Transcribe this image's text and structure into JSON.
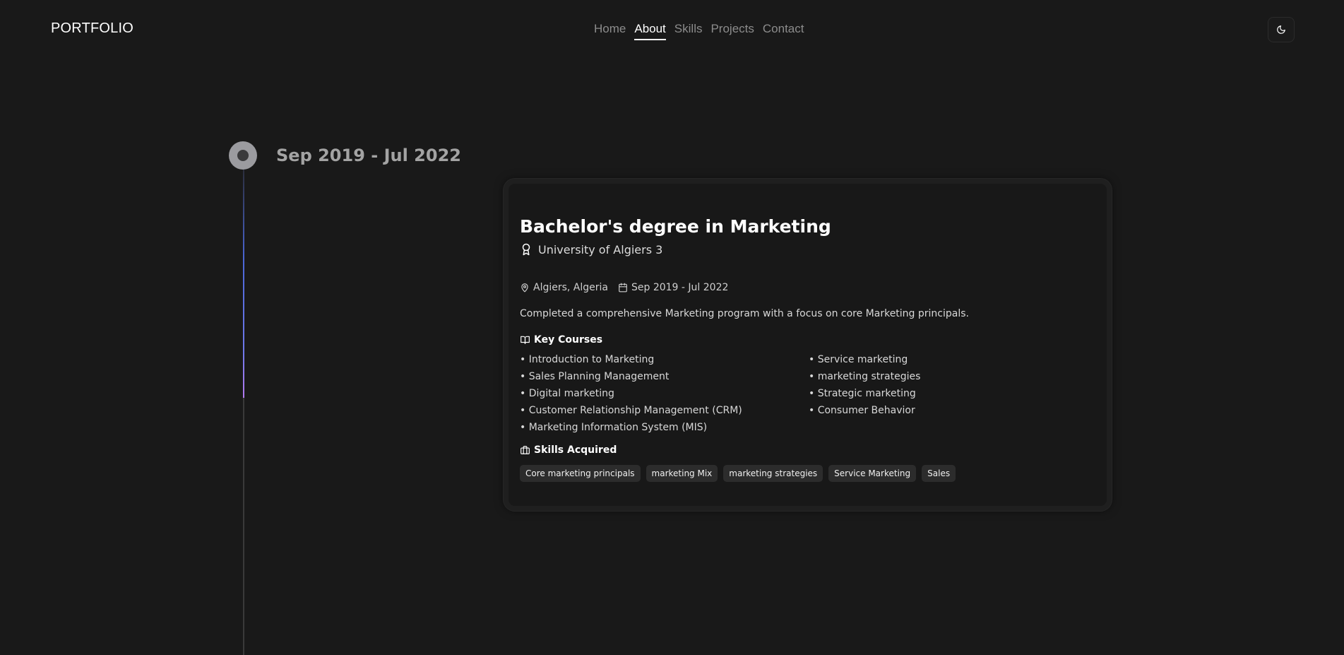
{
  "header": {
    "logo": "PORTFOLIO",
    "nav": [
      "Home",
      "About",
      "Skills",
      "Projects",
      "Contact"
    ],
    "active_nav": "About",
    "theme_toggle_icon": "moon-icon"
  },
  "timeline": {
    "date": "Sep 2019 - Jul 2022"
  },
  "card": {
    "title": "Bachelor's degree in Marketing",
    "institution": "University of Algiers 3",
    "location": "Algiers, Algeria",
    "period": "Sep 2019 - Jul 2022",
    "description": "Completed a comprehensive Marketing program with a focus on core Marketing principals.",
    "courses_heading": "Key Courses",
    "courses_left": [
      "• Introduction to Marketing",
      "• Sales Planning Management",
      "• Digital marketing",
      "• Customer Relationship Management (CRM)",
      "• Marketing Information System (MIS)"
    ],
    "courses_right": [
      "• Service marketing",
      "• marketing strategies",
      "• Strategic marketing",
      "• Consumer Behavior"
    ],
    "skills_heading": "Skills Acquired",
    "skills": [
      "Core marketing principals",
      "marketing Mix",
      "marketing strategies",
      "Service Marketing",
      "Sales"
    ]
  },
  "colors": {
    "background": "#191919",
    "timeline_gradient_start": "#4b67d8",
    "timeline_gradient_end": "#b37af0",
    "tag_background": "#2c2c2c"
  }
}
